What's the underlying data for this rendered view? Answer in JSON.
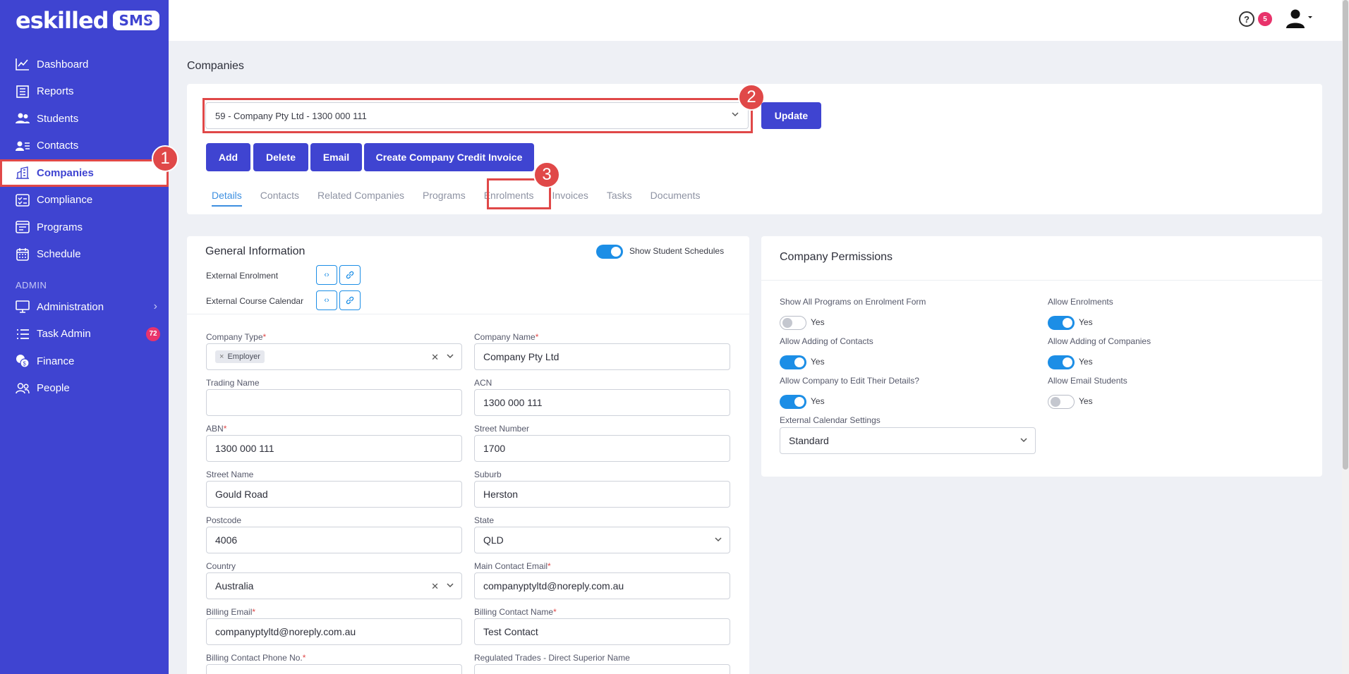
{
  "brand": {
    "name": "eskilled",
    "badge": "SMS"
  },
  "sidebar": {
    "items": [
      {
        "label": "Dashboard"
      },
      {
        "label": "Reports"
      },
      {
        "label": "Students"
      },
      {
        "label": "Contacts"
      },
      {
        "label": "Companies",
        "active": true
      },
      {
        "label": "Compliance"
      },
      {
        "label": "Programs"
      },
      {
        "label": "Schedule"
      }
    ],
    "section_label": "ADMIN",
    "admin_items": [
      {
        "label": "Administration"
      },
      {
        "label": "Task Admin",
        "badge": "72"
      },
      {
        "label": "Finance"
      },
      {
        "label": "People"
      }
    ]
  },
  "topbar": {
    "notifications": "5"
  },
  "page": {
    "title": "Companies"
  },
  "company_selector": {
    "value": "59 - Company Pty Ltd - 1300 000 111",
    "update_label": "Update"
  },
  "actions": {
    "add": "Add",
    "delete": "Delete",
    "email": "Email",
    "credit_invoice": "Create Company Credit Invoice"
  },
  "tabs": [
    "Details",
    "Contacts",
    "Related Companies",
    "Programs",
    "Enrolments",
    "Invoices",
    "Tasks",
    "Documents"
  ],
  "steps": {
    "one": "1",
    "two": "2",
    "three": "3"
  },
  "general": {
    "title": "General Information",
    "show_schedules": "Show Student Schedules",
    "external_enrolment": "External Enrolment",
    "external_calendar": "External Course Calendar",
    "fields": {
      "company_type": {
        "label": "Company Type",
        "value": "Employer"
      },
      "company_name": {
        "label": "Company Name",
        "value": "Company Pty Ltd"
      },
      "trading_name": {
        "label": "Trading Name",
        "value": ""
      },
      "acn": {
        "label": "ACN",
        "value": "1300 000 111"
      },
      "abn": {
        "label": "ABN",
        "value": "1300 000 111"
      },
      "street_number": {
        "label": "Street Number",
        "value": "1700"
      },
      "street_name": {
        "label": "Street Name",
        "value": "Gould Road"
      },
      "suburb": {
        "label": "Suburb",
        "value": "Herston"
      },
      "postcode": {
        "label": "Postcode",
        "value": "4006"
      },
      "state": {
        "label": "State",
        "value": "QLD"
      },
      "country": {
        "label": "Country",
        "value": "Australia"
      },
      "main_contact_email": {
        "label": "Main Contact Email",
        "value": "companyptyltd@noreply.com.au"
      },
      "billing_email": {
        "label": "Billing Email",
        "value": "companyptyltd@noreply.com.au"
      },
      "billing_contact_name": {
        "label": "Billing Contact Name",
        "value": "Test Contact"
      },
      "billing_phone": {
        "label": "Billing Contact Phone No.",
        "value": ""
      },
      "regulated_trades": {
        "label": "Regulated Trades - Direct Superior Name",
        "value": ""
      }
    }
  },
  "permissions": {
    "title": "Company Permissions",
    "yes": "Yes",
    "items": [
      {
        "label": "Show All Programs on Enrolment Form",
        "on": false
      },
      {
        "label": "Allow Enrolments",
        "on": true
      },
      {
        "label": "Allow Adding of Contacts",
        "on": true
      },
      {
        "label": "Allow Adding of Companies",
        "on": true
      },
      {
        "label": "Allow Company to Edit Their Details?",
        "on": true
      },
      {
        "label": "Allow Email Students",
        "on": false
      }
    ],
    "calendar_label": "External Calendar Settings",
    "calendar_value": "Standard"
  }
}
